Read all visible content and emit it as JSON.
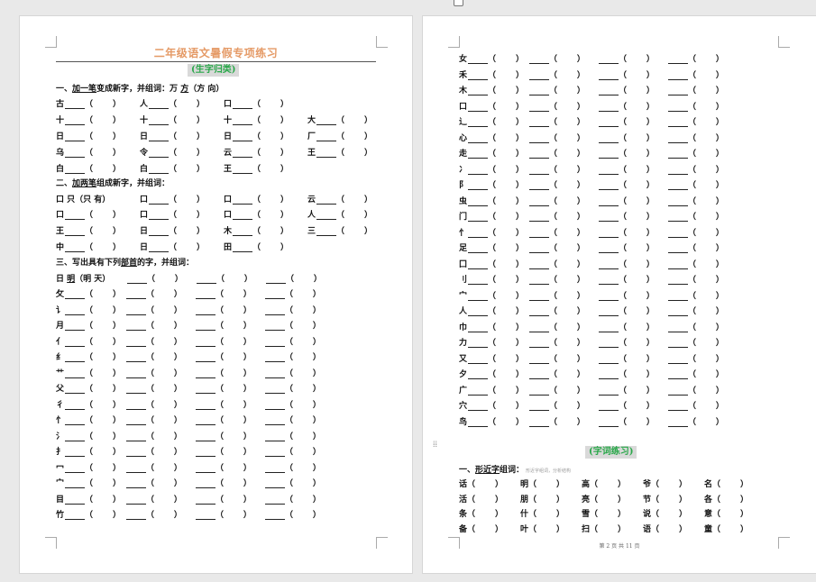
{
  "page1": {
    "title": "二年级语文暑假专项练习",
    "section_badge": "(生字归类)",
    "q1": {
      "heading_prefix": "一、",
      "heading_u": "加一笔",
      "heading_mid": "变成新字，并组词：",
      "heading_example_char": "万",
      "heading_example_rest": "方",
      "heading_example_paren": "（方  向）",
      "rows": [
        [
          "古",
          "人",
          "口"
        ],
        [
          "十",
          "十",
          "十",
          "大"
        ],
        [
          "日",
          "日",
          "日",
          "厂"
        ],
        [
          "乌",
          "令",
          "云",
          "王"
        ],
        [
          "白",
          "白",
          "王"
        ]
      ]
    },
    "q2": {
      "heading_prefix": "二、",
      "heading_u": "加两笔",
      "heading_rest": "组成新字，并组词：",
      "example_char": "口",
      "example_answer": "只",
      "example_word": "（只  有）",
      "rows": [
        [
          "口",
          "口",
          "云"
        ],
        [
          "口",
          "口",
          "口",
          "人"
        ],
        [
          "王",
          "日",
          "木",
          "三"
        ],
        [
          "中",
          "日",
          "田"
        ]
      ]
    },
    "q3": {
      "heading_prefix": "三、写出具有下列",
      "heading_u": "部首",
      "heading_rest": "的字，并组词：",
      "example_radical": "日",
      "example_char": "明",
      "example_word": "（明  天）",
      "radicals": [
        "攵",
        "讠",
        "月",
        "亻",
        "纟",
        "艹",
        "父",
        "彳",
        "忄",
        "氵",
        "扌",
        "冖",
        "宀",
        "目",
        "竹"
      ]
    }
  },
  "page2": {
    "radicals": [
      "女",
      "禾",
      "木",
      "口",
      "辶",
      "心",
      "走",
      "冫",
      "阝",
      "虫",
      "门",
      "忄",
      "足",
      "囗",
      "刂",
      "宀",
      "人",
      "巾",
      "力",
      "又",
      "夕",
      "广",
      "穴",
      "鸟"
    ],
    "section_badge": "(字词练习)",
    "q1": {
      "heading_prefix": "一、",
      "heading_u": "形近字",
      "heading_rest": "组词：",
      "note": "形近字组词，分析结构"
    },
    "pairs": [
      [
        "话",
        "明",
        "高",
        "爷",
        "名"
      ],
      [
        "活",
        "朋",
        "亮",
        "节",
        "各"
      ],
      [
        "条",
        "什",
        "雪",
        "说",
        "意"
      ],
      [
        "备",
        "叶",
        "扫",
        "语",
        "童"
      ]
    ],
    "footer": "第 2 页  共 11 页"
  }
}
